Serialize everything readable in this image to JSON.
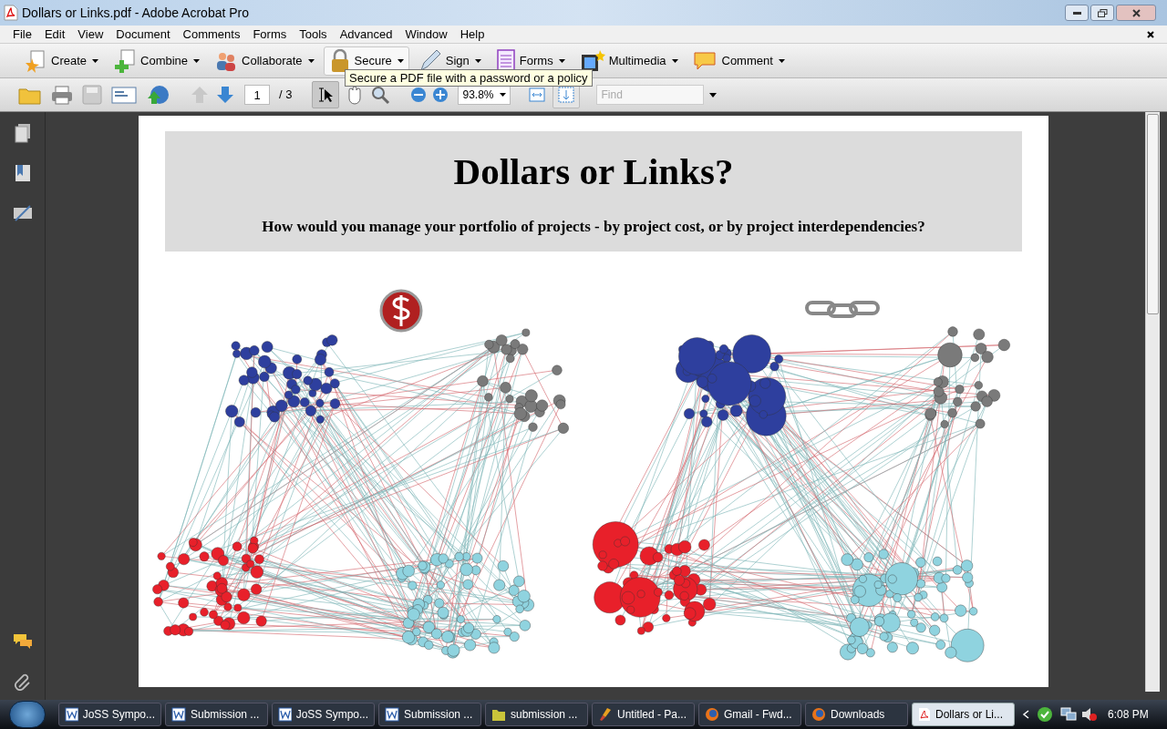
{
  "window": {
    "title": "Dollars or Links.pdf - Adobe Acrobat Pro"
  },
  "menu": [
    "File",
    "Edit",
    "View",
    "Document",
    "Comments",
    "Forms",
    "Tools",
    "Advanced",
    "Window",
    "Help"
  ],
  "tasks_toolbar": [
    {
      "label": "Create",
      "kind": "create",
      "selected": false
    },
    {
      "label": "Combine",
      "kind": "combine",
      "selected": false
    },
    {
      "label": "Collaborate",
      "kind": "collaborate",
      "selected": false
    },
    {
      "label": "Secure",
      "kind": "secure",
      "selected": true
    },
    {
      "label": "Sign",
      "kind": "sign",
      "selected": false
    },
    {
      "label": "Forms",
      "kind": "forms",
      "selected": false
    },
    {
      "label": "Multimedia",
      "kind": "multimedia",
      "selected": false
    },
    {
      "label": "Comment",
      "kind": "comment",
      "selected": false
    }
  ],
  "tooltip": "Secure a PDF file with a password or a policy",
  "nav_toolbar": {
    "page": "1",
    "page_count": "/ 3",
    "zoom": "93.8%",
    "find_placeholder": "Find"
  },
  "document": {
    "title": "Dollars or Links?",
    "subtitle": "How would you manage your portfolio of projects - by project cost, or by project interdependencies?"
  },
  "taskbar": [
    {
      "label": "JoSS Sympo...",
      "kind": "word",
      "selected": false
    },
    {
      "label": "Submission ...",
      "kind": "word",
      "selected": false
    },
    {
      "label": "JoSS Sympo...",
      "kind": "word",
      "selected": false
    },
    {
      "label": "Submission ...",
      "kind": "word",
      "selected": false
    },
    {
      "label": "submission ...",
      "kind": "folder",
      "selected": false
    },
    {
      "label": "Untitled - Pa...",
      "kind": "paint",
      "selected": false
    },
    {
      "label": "Gmail - Fwd...",
      "kind": "firefox",
      "selected": false
    },
    {
      "label": "Downloads",
      "kind": "firefox",
      "selected": false
    },
    {
      "label": "Dollars or Li...",
      "kind": "pdf",
      "selected": true
    }
  ],
  "clock": "6:08 PM"
}
